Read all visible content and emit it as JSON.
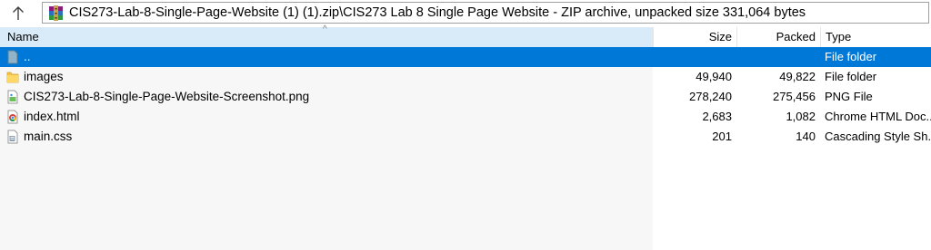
{
  "addressbar": {
    "up_label": "↑",
    "path": "CIS273-Lab-8-Single-Page-Website (1) (1).zip\\CIS273 Lab 8 Single Page Website - ZIP archive, unpacked size 331,064 bytes"
  },
  "columns": {
    "name": "Name",
    "size": "Size",
    "packed": "Packed",
    "type": "Type"
  },
  "rows": [
    {
      "name": "..",
      "size": "",
      "packed": "",
      "type": "File folder",
      "icon": "parent-folder-icon",
      "selected": true
    },
    {
      "name": "images",
      "size": "49,940",
      "packed": "49,822",
      "type": "File folder",
      "icon": "folder-icon",
      "selected": false
    },
    {
      "name": "CIS273-Lab-8-Single-Page-Website-Screenshot.png",
      "size": "278,240",
      "packed": "275,456",
      "type": "PNG File",
      "icon": "png-file-icon",
      "selected": false
    },
    {
      "name": "index.html",
      "size": "2,683",
      "packed": "1,082",
      "type": "Chrome HTML Doc...",
      "icon": "chrome-html-icon",
      "selected": false
    },
    {
      "name": "main.css",
      "size": "201",
      "packed": "140",
      "type": "Cascading Style Sh...",
      "icon": "css-file-icon",
      "selected": false
    }
  ],
  "colors": {
    "selection": "#0078d7",
    "header_highlight": "#d9ebf9",
    "name_column_bg": "#f7f7f7"
  }
}
